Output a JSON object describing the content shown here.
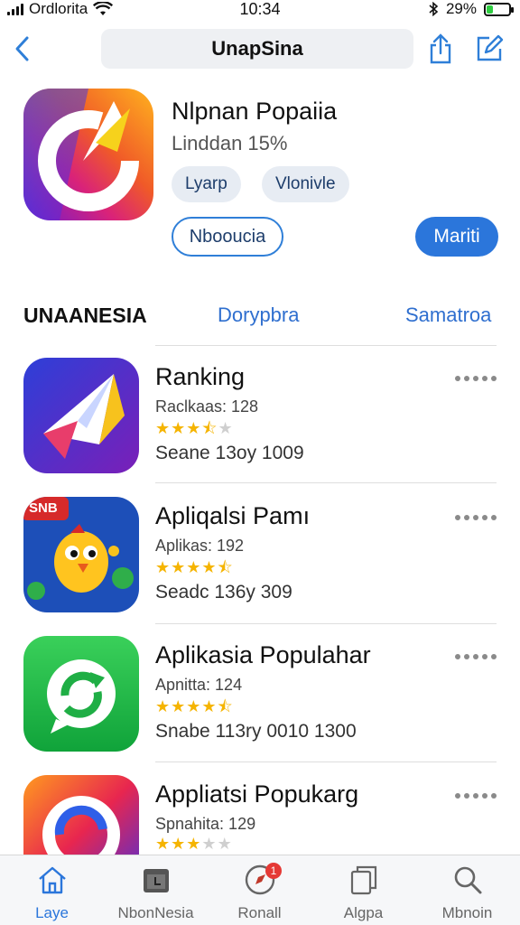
{
  "status_bar": {
    "carrier": "Ordlorita",
    "time": "10:34",
    "battery": "29%",
    "battery_level": 0.29,
    "icons": [
      "signal-icon",
      "wifi-icon",
      "bluetooth-icon",
      "battery-icon"
    ]
  },
  "nav": {
    "title": "UnapSina",
    "icons": [
      "back-chevron-icon",
      "share-icon",
      "edit-icon"
    ]
  },
  "hero": {
    "title": "Nlpnan Popaiia",
    "subtitle": "Linddan 15%",
    "tags": [
      "Lyarp",
      "Vlonivle"
    ],
    "button_outline": "Nbooucia",
    "button_primary": "Mariti"
  },
  "section": {
    "title": "UNAANESIA",
    "tabs": [
      "Dorypbra",
      "Samatroa"
    ]
  },
  "apps": [
    {
      "name": "Ranking",
      "meta": "Raclkaas: 128",
      "rating": 3.5,
      "extra": "Seane  13oy  1009",
      "icon": "paper-plane-icon"
    },
    {
      "name": "Apliqalsi Pamı",
      "meta": "Aplikas: 192",
      "rating": 4.5,
      "extra": "Seadc  136y  309",
      "icon": "cartoon-bird-icon",
      "icon_badge": "SNB"
    },
    {
      "name": "Aplikasia Populahar",
      "meta": "Apnitta: 124",
      "rating": 4.5,
      "extra": "Snabe  113ry  0010  1300",
      "icon": "chat-refresh-icon"
    },
    {
      "name": "Appliatsi Popukarg",
      "meta": "Spnahita: 129",
      "rating": 3,
      "extra": "",
      "icon": "swirl-logo-icon"
    }
  ],
  "tabbar": {
    "items": [
      {
        "label": "Laye",
        "icon": "home-icon",
        "active": true
      },
      {
        "label": "NbonNesia",
        "icon": "calendar-icon",
        "active": false
      },
      {
        "label": "Ronall",
        "icon": "compass-icon",
        "active": false,
        "badge": "1"
      },
      {
        "label": "Algpa",
        "icon": "stack-icon",
        "active": false
      },
      {
        "label": "Mbnoin",
        "icon": "search-icon",
        "active": false
      }
    ]
  },
  "colors": {
    "accent": "#2b76db",
    "star": "#f5b400",
    "badge": "#e53935"
  }
}
